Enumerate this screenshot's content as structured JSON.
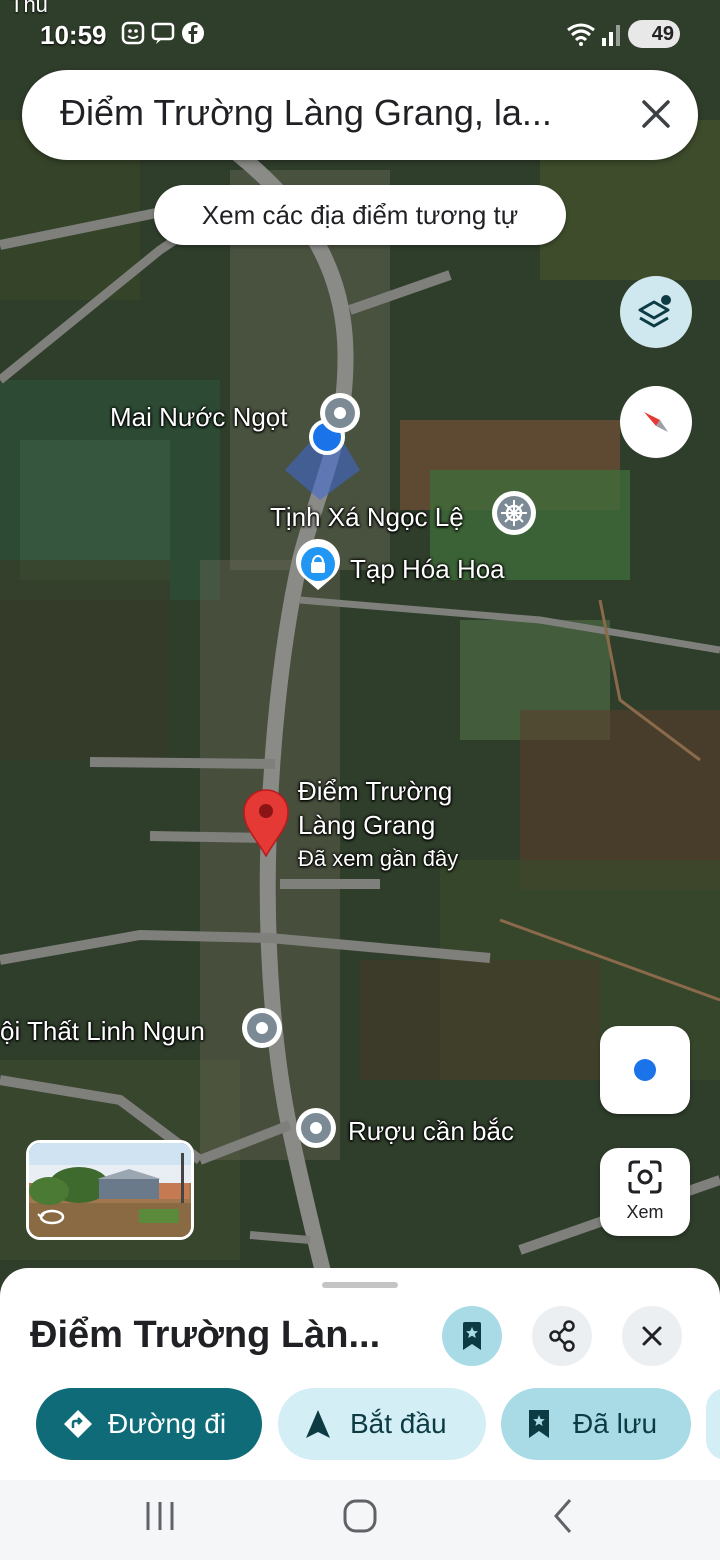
{
  "status_bar": {
    "carrier": "Thu",
    "time": "10:59",
    "battery": "49"
  },
  "search": {
    "query": "Điểm Trường Làng Grang, la..."
  },
  "similar_places_chip": "Xem các địa điểm tương tự",
  "map_labels": {
    "mai_nuoc_ngot": "Mai Nước Ngọt",
    "tinh_xa": "Tịnh Xá Ngọc Lệ",
    "tap_hoa": "Tạp Hóa Hoa",
    "destination_line1": "Điểm Trường",
    "destination_line2": "Làng Grang",
    "destination_note": "Đã xem gần đây",
    "noi_that": "ội Thất Linh Ngun",
    "ruou": "Rượu cần bắc"
  },
  "lens_label": "Xem",
  "sheet": {
    "title": "Điểm Trường Làn...",
    "directions": "Đường đi",
    "start": "Bắt đầu",
    "saved": "Đã lưu"
  },
  "colors": {
    "accent": "#0e6b77",
    "pin": "#e53935",
    "location": "#1a73e8"
  }
}
